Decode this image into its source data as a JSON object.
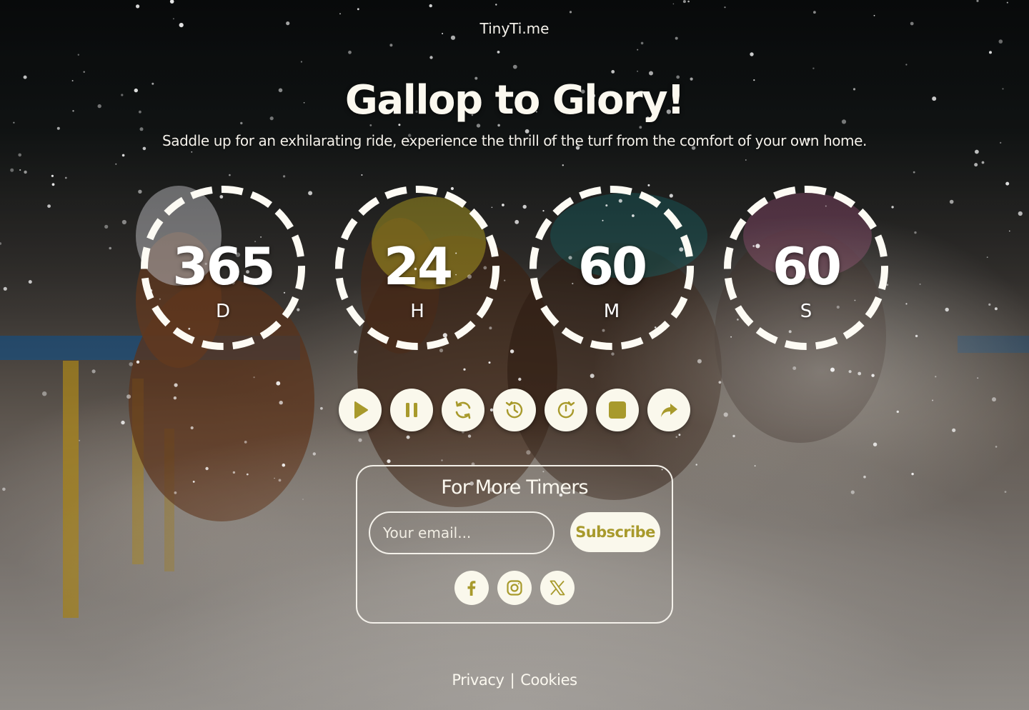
{
  "brand": "TinyTi.me",
  "hero": {
    "title": "Gallop to Glory!",
    "subtitle": "Saddle up for an exhilarating ride, experience the thrill of the turf from the comfort of your own home."
  },
  "countdown": [
    {
      "value": "365",
      "unit": "D"
    },
    {
      "value": "24",
      "unit": "H"
    },
    {
      "value": "60",
      "unit": "M"
    },
    {
      "value": "60",
      "unit": "S"
    }
  ],
  "controls": [
    {
      "icon": "play-icon"
    },
    {
      "icon": "pause-icon"
    },
    {
      "icon": "refresh-icon"
    },
    {
      "icon": "history-icon"
    },
    {
      "icon": "timer-reset-icon"
    },
    {
      "icon": "stop-icon"
    },
    {
      "icon": "share-icon"
    }
  ],
  "subscribe": {
    "title": "For More Timers",
    "email_placeholder": "Your email...",
    "button_label": "Subscribe"
  },
  "socials": [
    {
      "icon": "facebook-icon"
    },
    {
      "icon": "instagram-icon"
    },
    {
      "icon": "x-icon"
    }
  ],
  "footer": {
    "privacy": "Privacy",
    "separator": "|",
    "cookies": "Cookies"
  },
  "colors": {
    "accent": "#a89a2c",
    "button_bg": "#faf8ec",
    "text": "#fbf8ef"
  }
}
